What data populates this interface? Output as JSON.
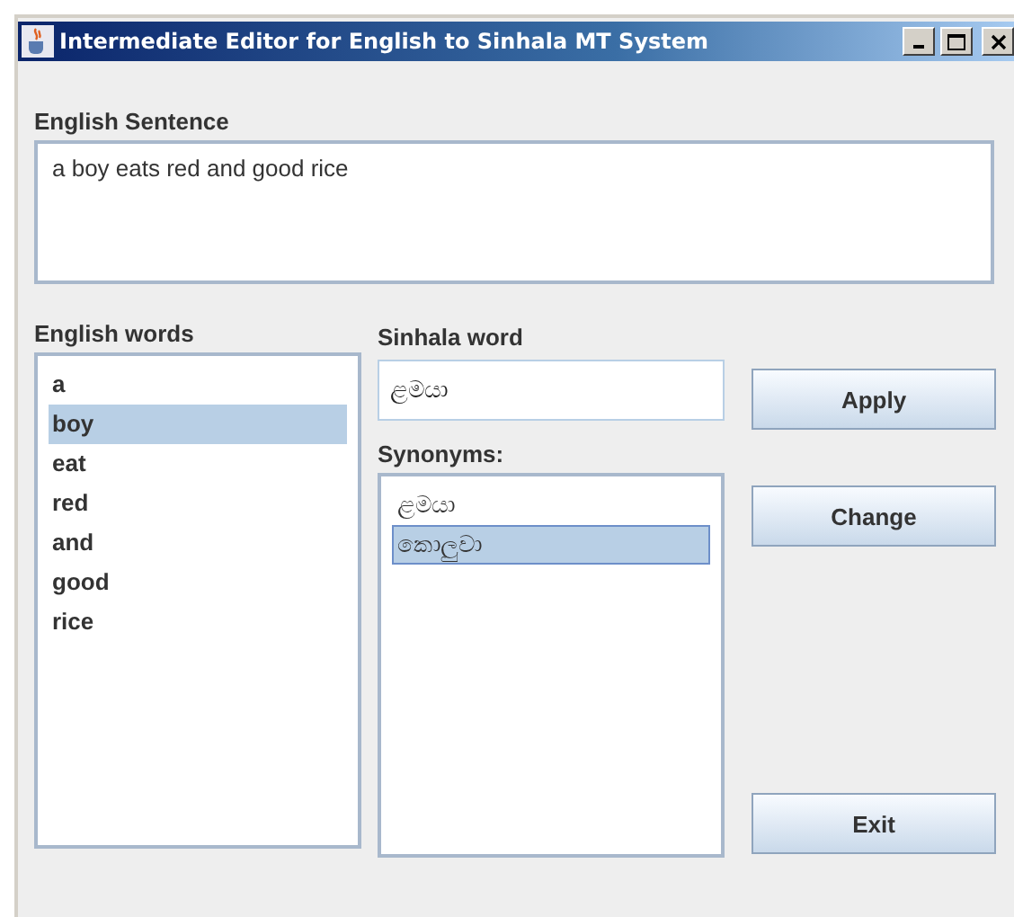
{
  "window": {
    "title": "Intermediate Editor for English to Sinhala MT System"
  },
  "english_sentence": {
    "label": "English Sentence",
    "value": "a boy eats red and good rice"
  },
  "english_words": {
    "label": "English words",
    "items": [
      {
        "text": "a",
        "selected": false
      },
      {
        "text": "boy",
        "selected": true
      },
      {
        "text": "eat",
        "selected": false
      },
      {
        "text": "red",
        "selected": false
      },
      {
        "text": "and",
        "selected": false
      },
      {
        "text": "good",
        "selected": false
      },
      {
        "text": "rice",
        "selected": false
      }
    ]
  },
  "sinhala_word": {
    "label": "Sinhala word",
    "value": "ළමයා"
  },
  "synonyms": {
    "label": "Synonyms:",
    "items": [
      {
        "text": "ළමයා",
        "selected": false
      },
      {
        "text": "කොලුවා",
        "selected": true
      }
    ]
  },
  "buttons": [
    {
      "label": "Apply"
    },
    {
      "label": "Change"
    },
    {
      "label": "Exit"
    }
  ]
}
